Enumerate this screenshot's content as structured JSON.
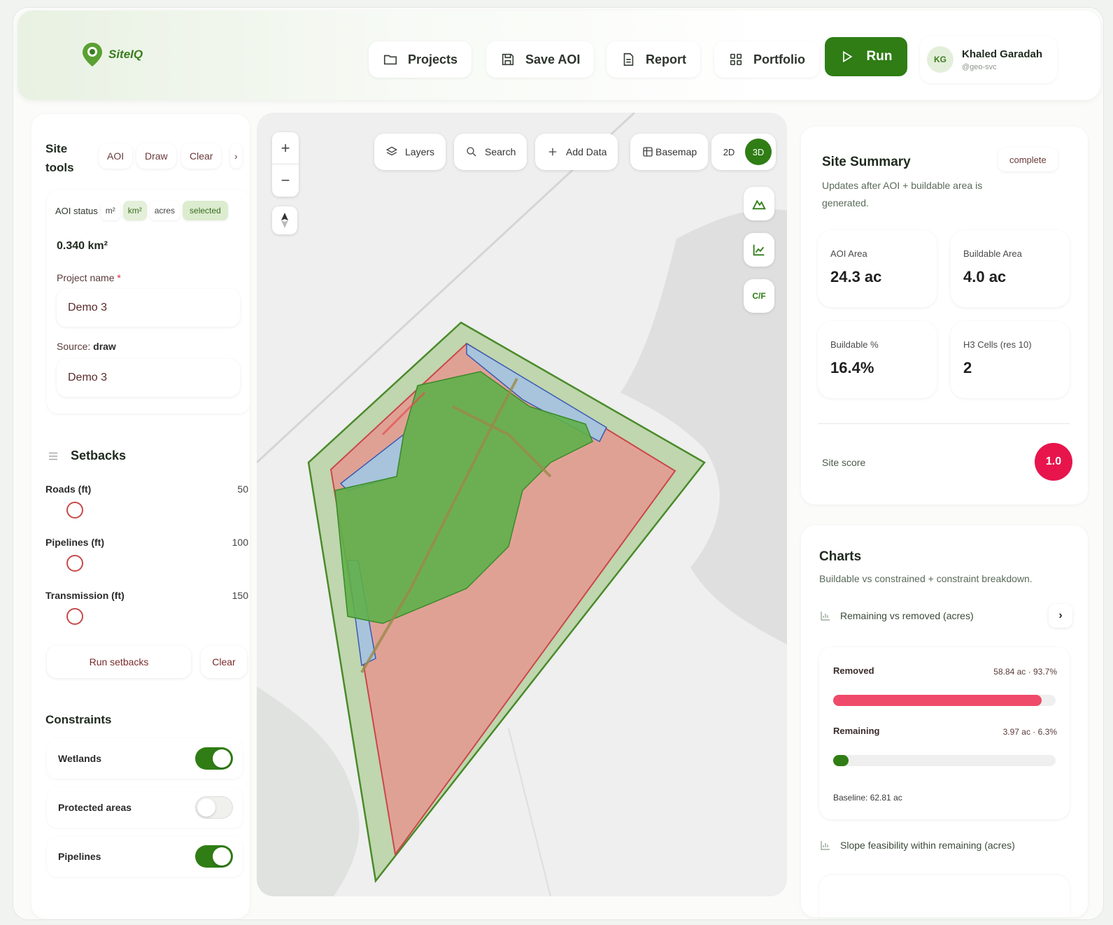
{
  "app": {
    "logo_text": "SiteIQ",
    "accent": "#2f7d14"
  },
  "header": {
    "projects_label": "Projects",
    "save_aoi_label": "Save AOI",
    "report_label": "Report",
    "portfolio_label": "Portfolio",
    "run_label": "Run",
    "user": {
      "initials": "KG",
      "name": "Khaled Garadah",
      "handle": "@geo-svc"
    }
  },
  "left": {
    "site_tools_label": "Site tools",
    "tools": [
      "AOI",
      "Draw",
      "Clear"
    ],
    "aoi": {
      "status_label": "AOI status",
      "units": [
        "m²",
        "km²",
        "acres"
      ],
      "active_unit": "km²",
      "selected_label": "selected",
      "area": "0.340 km²",
      "project_name_label": "Project name",
      "project_name_value": "Demo 3",
      "source_label": "Source:",
      "source_value": "draw",
      "source_name_value": "Demo 3"
    },
    "setbacks": {
      "title": "Setbacks",
      "items": [
        {
          "label": "Roads (ft)",
          "value": "50"
        },
        {
          "label": "Pipelines (ft)",
          "value": "100"
        },
        {
          "label": "Transmission (ft)",
          "value": "150"
        }
      ],
      "run_label": "Run setbacks",
      "clear_label": "Clear"
    },
    "constraints": {
      "title": "Constraints",
      "items": [
        {
          "label": "Wetlands",
          "on": true
        },
        {
          "label": "Protected areas",
          "on": false
        },
        {
          "label": "Pipelines",
          "on": true
        }
      ]
    }
  },
  "map": {
    "tools": {
      "layers": "Layers",
      "search": "Search",
      "add_data": "Add Data",
      "basemap": "Basemap"
    },
    "dim_2d": "2D",
    "dim_3d": "3D",
    "active_dim": "3D",
    "side_cf": "C/F",
    "colors": {
      "aoi_buffer": "#8fbd6e",
      "buildable": "#5fb04a",
      "removed": "#ee8a8a",
      "water": "#a8c4dc"
    }
  },
  "summary": {
    "title": "Site Summary",
    "subtitle": "Updates after AOI + buildable area is generated.",
    "status": "complete",
    "metrics": [
      {
        "label": "AOI Area",
        "value": "24.3 ac"
      },
      {
        "label": "Buildable Area",
        "value": "4.0 ac"
      },
      {
        "label": "Buildable %",
        "value": "16.4%"
      },
      {
        "label": "H3 Cells (res 10)",
        "value": "2"
      }
    ],
    "score_label": "Site score",
    "score_value": "1.0",
    "score_color": "#e7154c"
  },
  "charts": {
    "title": "Charts",
    "subtitle": "Buildable vs constrained + constraint breakdown.",
    "chart1_title": "Remaining vs removed (acres)",
    "chart2_title": "Slope feasibility within remaining (acres)",
    "chart_data": {
      "type": "bar",
      "categories": [
        "Removed",
        "Remaining"
      ],
      "values": [
        58.84,
        3.97
      ],
      "percents": [
        93.7,
        6.3
      ],
      "value_labels": [
        "58.84 ac · 93.7%",
        "3.97 ac · 6.3%"
      ],
      "colors": [
        "#ef4a6a",
        "#2f7d14"
      ],
      "baseline_label": "Baseline: 62.81 ac"
    }
  }
}
